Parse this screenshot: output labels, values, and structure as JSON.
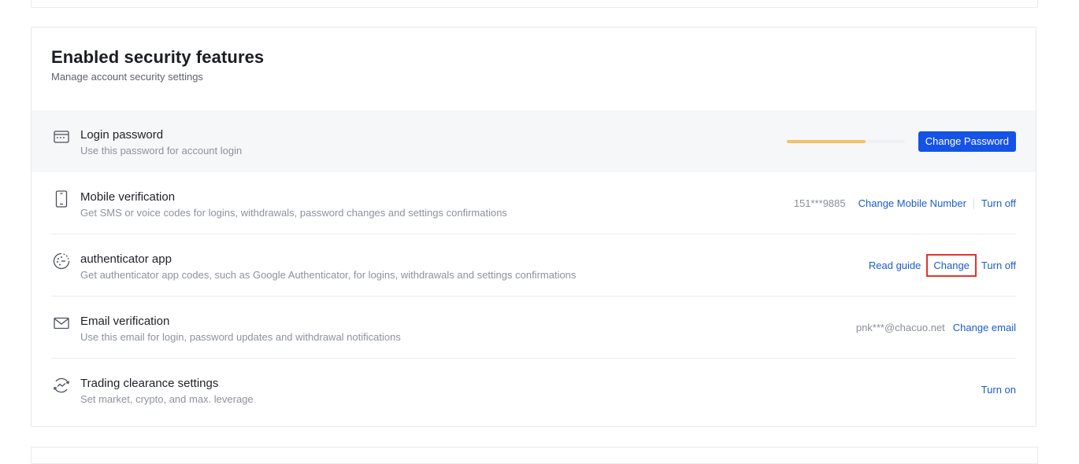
{
  "section": {
    "title": "Enabled security features",
    "subtitle": "Manage account security settings"
  },
  "rows": {
    "login_password": {
      "icon": "password-window-icon",
      "title": "Login password",
      "description": "Use this password for account login",
      "strength_level": 0.67,
      "strength_color": "#f5c06a",
      "action_label": "Change Password"
    },
    "mobile": {
      "icon": "mobile-phone-icon",
      "title": "Mobile verification",
      "description": "Get SMS or voice codes for logins, withdrawals, password changes and settings confirmations",
      "value": "151***9885",
      "change_label": "Change Mobile Number",
      "off_label": "Turn off"
    },
    "authenticator": {
      "icon": "authenticator-icon",
      "title": "authenticator app",
      "description": "Get authenticator app codes, such as Google Authenticator, for logins, withdrawals and settings confirmations",
      "guide_label": "Read guide",
      "change_label": "Change",
      "off_label": "Turn off"
    },
    "email": {
      "icon": "envelope-icon",
      "title": "Email verification",
      "description": "Use this email for login, password updates and withdrawal notifications",
      "value": "pnk***@chacuo.net",
      "change_label": "Change email"
    },
    "trading": {
      "icon": "trading-clearance-icon",
      "title": "Trading clearance settings",
      "description": "Set market, crypto, and max. leverage",
      "on_label": "Turn on"
    }
  },
  "colors": {
    "link": "#1b5ccf",
    "primary_button": "#1552e6",
    "highlight_border": "#e2352b"
  }
}
